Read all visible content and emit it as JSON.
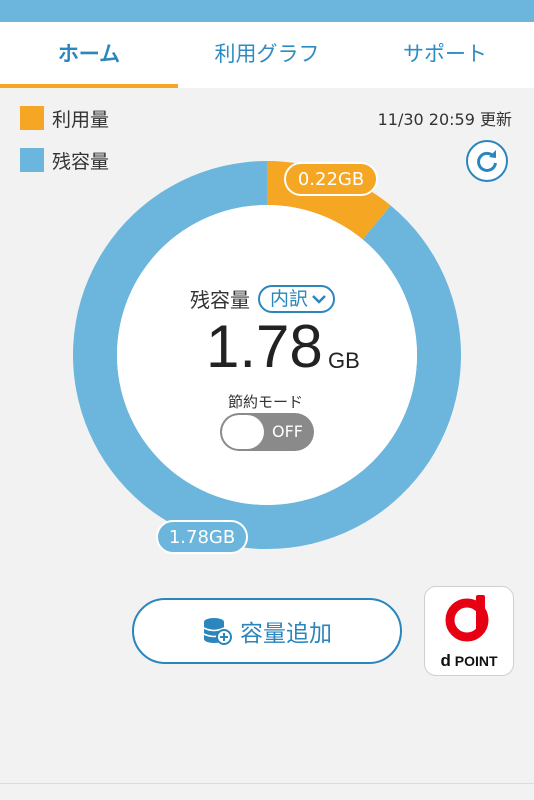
{
  "tabs": [
    {
      "label": "ホーム",
      "active": true
    },
    {
      "label": "利用グラフ"
    },
    {
      "label": "サポート"
    }
  ],
  "legend": {
    "used_label": "利用量",
    "remaining_label": "残容量",
    "used_color": "#f5a623",
    "remaining_color": "#6cb6dd"
  },
  "updated_text": "11/30 20:59 更新",
  "icons": {
    "refresh": "refresh-icon",
    "add_data": "database-plus-icon",
    "dropdown": "chevron-down-icon"
  },
  "usage": {
    "used": 0.22,
    "remaining": 1.78,
    "used_pill": "0.22GB",
    "remaining_pill": "1.78GB"
  },
  "center": {
    "label": "残容量",
    "breakdown_label": "内訳",
    "value": "1.78",
    "unit": "GB",
    "save_mode_label": "節約モード",
    "save_mode_state": "OFF"
  },
  "actions": {
    "add_capacity_label": "容量追加",
    "dpoint_text": "POINT",
    "dpoint_letter": "d"
  },
  "colors": {
    "accent": "#2a86bd",
    "topbar": "#6cb6dd"
  }
}
